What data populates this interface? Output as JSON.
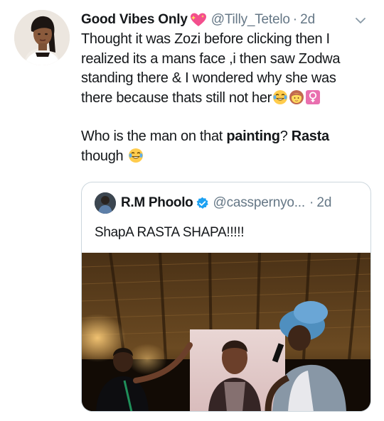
{
  "tweet": {
    "display_name": "Good Vibes Only",
    "handle": "@Tilly_Tetelo",
    "separator": "·",
    "time": "2d",
    "text_lines": [
      "Thought it was Zozi before clicking then I",
      "realized its a mans face ,i then saw Zodwa",
      "standing there & I wondered why she was"
    ],
    "text_line_4": "there because thats still not her",
    "para2_start": "Who is the man on that ",
    "para2_bold1": "painting",
    "para2_mid": "? ",
    "para2_bold2": "Rasta",
    "para2_line2": "though"
  },
  "quoted_tweet": {
    "display_name": "R.M Phoolo",
    "handle": "@casspernyo...",
    "separator": "·",
    "time": "2d",
    "text": "ShapA RASTA SHAPA!!!!!"
  },
  "icons": {
    "heart": "sparkling-heart-icon",
    "laugh": "tears-of-joy-emoji",
    "woman": "woman-emoji",
    "female": "female-sign-emoji",
    "verified": "verified-badge-icon",
    "chevron": "chevron-down-icon"
  },
  "colors": {
    "text": "#14171a",
    "secondary": "#657786",
    "verified": "#1da1f2",
    "heart": "#f34f8d",
    "border": "#ccd6dd"
  }
}
